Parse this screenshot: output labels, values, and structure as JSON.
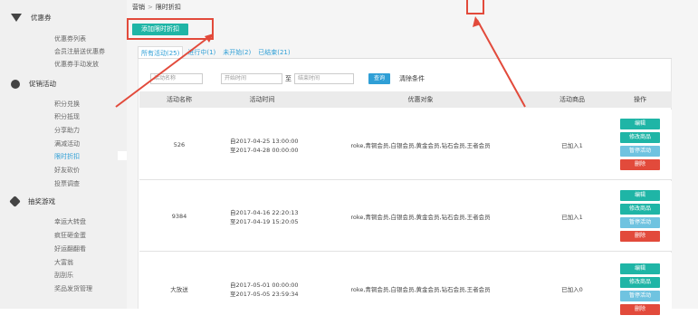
{
  "sidebar": {
    "groups": [
      {
        "title": "优惠券",
        "icon": "diamond-icon",
        "items": [
          "优惠券列表",
          "会员注册送优惠券",
          "优惠券手动发放"
        ]
      },
      {
        "title": "促销活动",
        "icon": "tag-icon",
        "items": [
          "积分兑换",
          "积分抵现",
          "分享助力",
          "满减活动",
          "限时折扣",
          "好友砍价",
          "投票调查"
        ],
        "active": "限时折扣"
      },
      {
        "title": "抽奖游戏",
        "icon": "pinwheel-icon",
        "items": [
          "幸运大转盘",
          "疯狂砸金蛋",
          "好运翻翻看",
          "大富翁",
          "刮刮乐",
          "奖品发货管理"
        ]
      }
    ]
  },
  "breadcrumb": {
    "root": "营销",
    "sep": ">",
    "current": "限时折扣"
  },
  "add_button": "添加限时折扣",
  "tabs": [
    "所有活动(25)",
    "进行中(1)",
    "未开始(2)",
    "已结束(21)"
  ],
  "filter": {
    "name_placeholder": "活动名称",
    "start_placeholder": "开始时间",
    "to": "至",
    "end_placeholder": "结束时间",
    "search": "查询",
    "clear": "清除条件"
  },
  "table": {
    "headers": [
      "活动名称",
      "活动时间",
      "优惠对象",
      "活动商品",
      "操作"
    ],
    "rows": [
      {
        "name": "526",
        "time_from": "自2017-04-25 13:00:00",
        "time_to": "至2017-04-28 00:00:00",
        "target": "roke,青铜会员,白银会员,黄金会员,钻石会员,王者会员",
        "goods": "已加入1",
        "actions": [
          "编辑",
          "修改商品",
          "暂停活动",
          "删除"
        ]
      },
      {
        "name": "9384",
        "time_from": "自2017-04-16 22:20:13",
        "time_to": "至2017-04-19 15:20:05",
        "target": "roke,青铜会员,白银会员,黄金会员,钻石会员,王者会员",
        "goods": "已加入1",
        "actions": [
          "编辑",
          "修改商品",
          "暂停活动",
          "删除"
        ]
      },
      {
        "name": "大放送",
        "time_from": "自2017-05-01 00:00:00",
        "time_to": "至2017-05-05 23:59:34",
        "target": "roke,青铜会员,白银会员,黄金会员,钻石会员,王者会员",
        "goods": "已加入0",
        "actions": [
          "编辑",
          "修改商品",
          "暂停活动",
          "删除"
        ]
      }
    ]
  },
  "colors": {
    "teal": "#1fb5a6",
    "blue": "#2f9fd6",
    "light_blue": "#6fc3e0",
    "red": "#e24a3b"
  }
}
